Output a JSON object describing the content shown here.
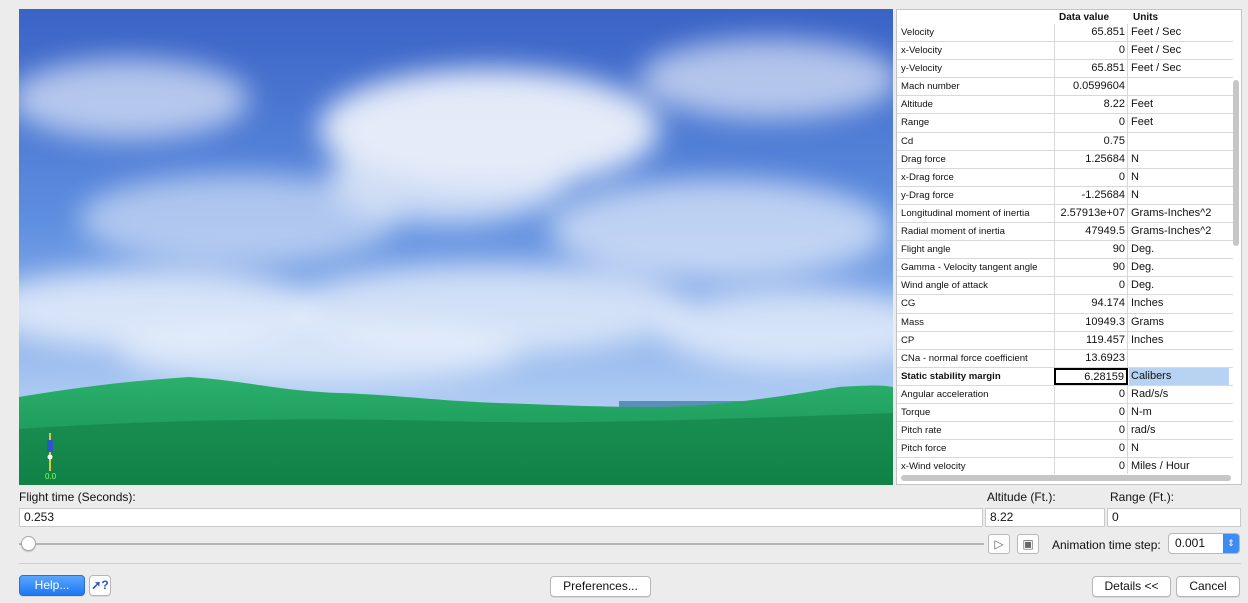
{
  "table": {
    "header": {
      "value": "Data value",
      "units": "Units"
    },
    "rows": [
      {
        "name": "Velocity",
        "value": "65.851",
        "units": "Feet / Sec"
      },
      {
        "name": "x-Velocity",
        "value": "0",
        "units": "Feet / Sec"
      },
      {
        "name": "y-Velocity",
        "value": "65.851",
        "units": "Feet / Sec"
      },
      {
        "name": "Mach number",
        "value": "0.0599604",
        "units": ""
      },
      {
        "name": "Altitude",
        "value": "8.22",
        "units": "Feet"
      },
      {
        "name": "Range",
        "value": "0",
        "units": "Feet"
      },
      {
        "name": "Cd",
        "value": "0.75",
        "units": ""
      },
      {
        "name": "Drag force",
        "value": "1.25684",
        "units": "N"
      },
      {
        "name": "x-Drag force",
        "value": "0",
        "units": "N"
      },
      {
        "name": "y-Drag force",
        "value": "-1.25684",
        "units": "N"
      },
      {
        "name": "Longitudinal moment of inertia",
        "value": "2.57913e+07",
        "units": "Grams-Inches^2"
      },
      {
        "name": "Radial moment of inertia",
        "value": "47949.5",
        "units": "Grams-Inches^2"
      },
      {
        "name": "Flight angle",
        "value": "90",
        "units": "Deg."
      },
      {
        "name": "Gamma - Velocity tangent angle",
        "value": "90",
        "units": "Deg."
      },
      {
        "name": "Wind angle of attack",
        "value": "0",
        "units": "Deg."
      },
      {
        "name": "CG",
        "value": "94.174",
        "units": "Inches"
      },
      {
        "name": "Mass",
        "value": "10949.3",
        "units": "Grams"
      },
      {
        "name": "CP",
        "value": "119.457",
        "units": "Inches"
      },
      {
        "name": "CNa - normal force coefficient",
        "value": "13.6923",
        "units": ""
      },
      {
        "name": "Static stability margin",
        "value": "6.28159",
        "units": "Calibers",
        "selected": true
      },
      {
        "name": "Angular acceleration",
        "value": "0",
        "units": "Rad/s/s"
      },
      {
        "name": "Torque",
        "value": "0",
        "units": "N-m"
      },
      {
        "name": "Pitch rate",
        "value": "0",
        "units": "rad/s"
      },
      {
        "name": "Pitch force",
        "value": "0",
        "units": "N"
      },
      {
        "name": "x-Wind velocity",
        "value": "0",
        "units": "Miles / Hour"
      }
    ]
  },
  "flight_time": {
    "label": "Flight time (Seconds):",
    "value": "0.253"
  },
  "altitude": {
    "label": "Altitude (Ft.):",
    "value": "8.22"
  },
  "range": {
    "label": "Range (Ft.):",
    "value": "0"
  },
  "animation": {
    "label": "Animation time step:",
    "selected": "0.001"
  },
  "scene": {
    "origin_label": "0.0"
  },
  "buttons": {
    "help": "Help...",
    "preferences": "Preferences...",
    "details": "Details <<",
    "cancel": "Cancel"
  },
  "colors": {
    "accent": "#3e8bf4",
    "sky": "#3a67c8",
    "grass": "#1f9b5e"
  }
}
